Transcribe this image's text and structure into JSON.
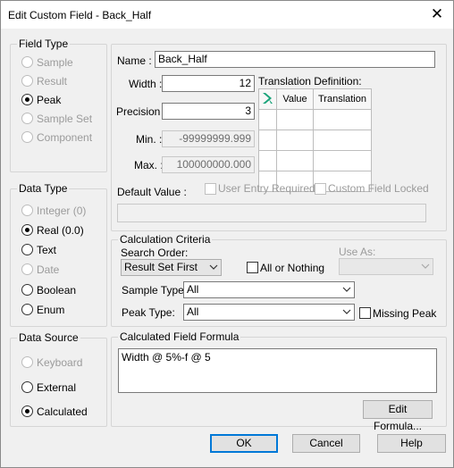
{
  "window": {
    "title": "Edit Custom Field - Back_Half",
    "close_icon": "close-icon"
  },
  "field_type": {
    "legend": "Field Type",
    "options": [
      {
        "label": "Sample",
        "enabled": false,
        "checked": false
      },
      {
        "label": "Result",
        "enabled": false,
        "checked": false
      },
      {
        "label": "Peak",
        "enabled": true,
        "checked": true
      },
      {
        "label": "Sample Set",
        "enabled": false,
        "checked": false
      },
      {
        "label": "Component",
        "enabled": false,
        "checked": false
      }
    ]
  },
  "data_type": {
    "legend": "Data Type",
    "options": [
      {
        "label": "Integer (0)",
        "enabled": false,
        "checked": false
      },
      {
        "label": "Real (0.0)",
        "enabled": true,
        "checked": true
      },
      {
        "label": "Text",
        "enabled": true,
        "checked": false
      },
      {
        "label": "Date",
        "enabled": false,
        "checked": false
      },
      {
        "label": "Boolean",
        "enabled": true,
        "checked": false
      },
      {
        "label": "Enum",
        "enabled": true,
        "checked": false
      }
    ]
  },
  "data_source": {
    "legend": "Data Source",
    "options": [
      {
        "label": "Keyboard",
        "enabled": false,
        "checked": false
      },
      {
        "label": "External",
        "enabled": true,
        "checked": false
      },
      {
        "label": "Calculated",
        "enabled": true,
        "checked": true
      }
    ]
  },
  "properties": {
    "name_label": "Name :",
    "name_value": "Back_Half",
    "width_label": "Width :",
    "width_value": "12",
    "precision_label": "Precision :",
    "precision_value": "3",
    "min_label": "Min. :",
    "min_value": "-99999999.999",
    "max_label": "Max. :",
    "max_value": "100000000.000",
    "default_value_label": "Default Value :",
    "default_value": "",
    "user_entry_required_label": "User Entry Required",
    "custom_field_locked_label": "Custom Field Locked"
  },
  "translation": {
    "label": "Translation Definition:",
    "columns": [
      "",
      "Value",
      "Translation"
    ],
    "rows": [
      [
        "",
        "",
        ""
      ],
      [
        "",
        "",
        ""
      ],
      [
        "",
        "",
        ""
      ],
      [
        "",
        "",
        ""
      ]
    ],
    "header_icon": "arrow-icon"
  },
  "calculation": {
    "legend": "Calculation Criteria",
    "search_order_label": "Search Order:",
    "search_order_value": "Result Set First",
    "all_or_nothing_label": "All or Nothing",
    "use_as_label": "Use As:",
    "use_as_value": "",
    "sample_type_label": "Sample Type:",
    "sample_type_value": "All",
    "peak_type_label": "Peak Type:",
    "peak_type_value": "All",
    "missing_peak_label": "Missing Peak"
  },
  "formula": {
    "legend": "Calculated Field Formula",
    "value": "Width @ 5%-f @ 5",
    "edit_button": "Edit Formula..."
  },
  "buttons": {
    "ok": "OK",
    "cancel": "Cancel",
    "help": "Help"
  },
  "colors": {
    "accent": "#0078d7",
    "icon_green": "#1aa37a"
  }
}
